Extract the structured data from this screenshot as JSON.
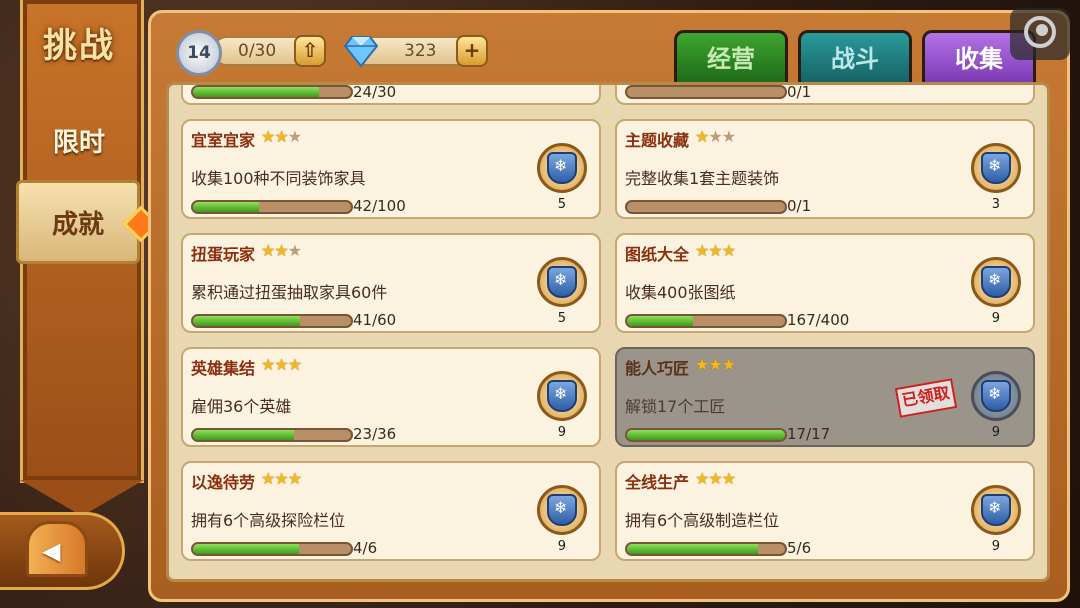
{
  "left_nav": {
    "title": "挑战",
    "items": [
      {
        "label": "限时"
      },
      {
        "label": "成就"
      }
    ]
  },
  "header": {
    "level": "14",
    "exp": "0/30",
    "gems": "323",
    "tabs": [
      {
        "label": "经营"
      },
      {
        "label": "战斗"
      },
      {
        "label": "收集"
      }
    ],
    "active_tab": "收集"
  },
  "partial_top": [
    {
      "progress": "24/30",
      "fraction": 0.8
    },
    {
      "progress": "0/1",
      "fraction": 0
    }
  ],
  "achievements": [
    {
      "name": "宜室宜家",
      "stars": 2,
      "desc": "收集100种不同装饰家具",
      "progress": "42/100",
      "fraction": 0.42,
      "reward": "5",
      "claimed": false
    },
    {
      "name": "主题收藏",
      "stars": 1,
      "desc": "完整收集1套主题装饰",
      "progress": "0/1",
      "fraction": 0,
      "reward": "3",
      "claimed": false
    },
    {
      "name": "扭蛋玩家",
      "stars": 2,
      "desc": "累积通过扭蛋抽取家具60件",
      "progress": "41/60",
      "fraction": 0.68,
      "reward": "5",
      "claimed": false
    },
    {
      "name": "图纸大全",
      "stars": 3,
      "desc": "收集400张图纸",
      "progress": "167/400",
      "fraction": 0.42,
      "reward": "9",
      "claimed": false
    },
    {
      "name": "英雄集结",
      "stars": 3,
      "desc": "雇佣36个英雄",
      "progress": "23/36",
      "fraction": 0.64,
      "reward": "9",
      "claimed": false
    },
    {
      "name": "能人巧匠",
      "stars": 3,
      "desc": "解锁17个工匠",
      "progress": "17/17",
      "fraction": 1,
      "reward": "9",
      "claimed": true,
      "stamp": "已领取"
    },
    {
      "name": "以逸待劳",
      "stars": 3,
      "desc": "拥有6个高级探险栏位",
      "progress": "4/6",
      "fraction": 0.67,
      "reward": "9",
      "claimed": false
    },
    {
      "name": "全线生产",
      "stars": 3,
      "desc": "拥有6个高级制造栏位",
      "progress": "5/6",
      "fraction": 0.83,
      "reward": "9",
      "claimed": false
    }
  ]
}
